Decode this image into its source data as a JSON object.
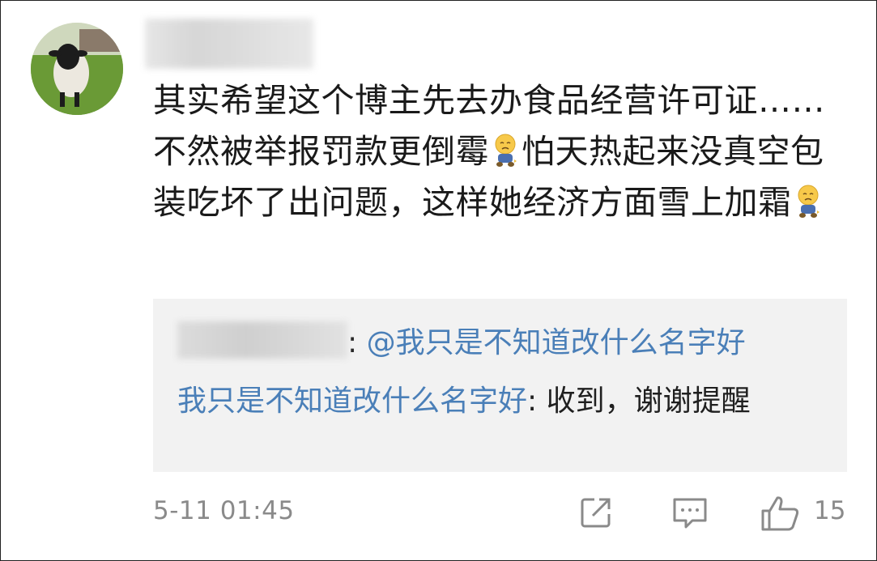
{
  "comment": {
    "text_part1": "其实希望这个博主先去办食品经营许可证……不然被举报罚款更倒霉",
    "text_part2": "怕天热起来没真空包装吃坏了出问题，这样她经济方面雪上加霜",
    "emoji_icon": "sad-baby-emoji-icon"
  },
  "reply": {
    "line1_separator": ": ",
    "line1_mention": "@我只是不知道改什么名字好",
    "line2_author": "我只是不知道改什么名字好",
    "line2_text": ": 收到，谢谢提醒"
  },
  "footer": {
    "timestamp": "5-11 01:45",
    "like_count": "15"
  },
  "colors": {
    "mention": "#4a7fb8",
    "text": "#1a1a1a",
    "meta": "#8a8a8a",
    "reply_bg": "#f2f2f2"
  }
}
